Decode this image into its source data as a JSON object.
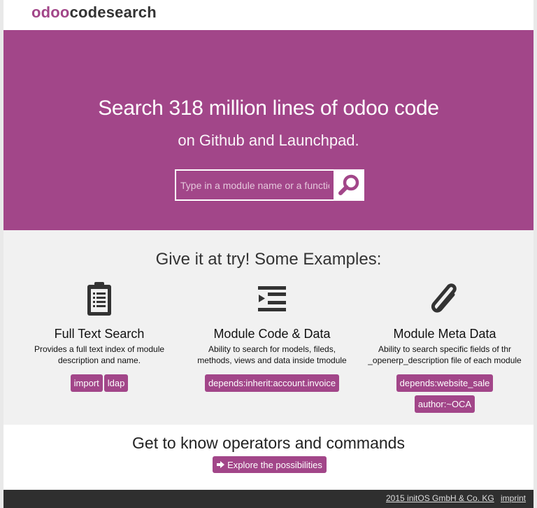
{
  "brand": {
    "part1": "odoo",
    "part2": "codesearch"
  },
  "hero": {
    "title": "Search 318 million lines of odoo code",
    "subtitle": "on Github and Launchpad.",
    "search_placeholder": "Type in a module name or a function",
    "search_icon": "magnifier-icon"
  },
  "examples": {
    "title": "Give it at try! Some Examples:",
    "features": [
      {
        "icon": "clipboard-icon",
        "title": "Full Text Search",
        "desc_line1": "Provides a full text index of module",
        "desc_line2": "description and name.",
        "tags": [
          "import",
          "ldap"
        ]
      },
      {
        "icon": "indent-icon",
        "title": "Module Code & Data",
        "desc_line1": "Ability to search for models, fileds,",
        "desc_line2": "methods, views and data inside tmodule",
        "tags": [
          "depends:inherit:account.invoice"
        ]
      },
      {
        "icon": "paperclip-icon",
        "title": "Module Meta Data",
        "desc_line1": "Ability to search specific fields of thr",
        "desc_line2": "_openerp_description file of each module",
        "tags": [
          "depends:website_sale",
          "author:~OCA"
        ]
      }
    ]
  },
  "operators": {
    "title": "Get to know operators and commands",
    "button_label": "Explore the possibilities"
  },
  "footer": {
    "copyright": "2015 initOS GmbH & Co. KG",
    "imprint": "imprint"
  },
  "colors": {
    "accent": "#a24689",
    "footer_bg": "#2f2f2f",
    "section_bg": "#f1f1f1"
  }
}
